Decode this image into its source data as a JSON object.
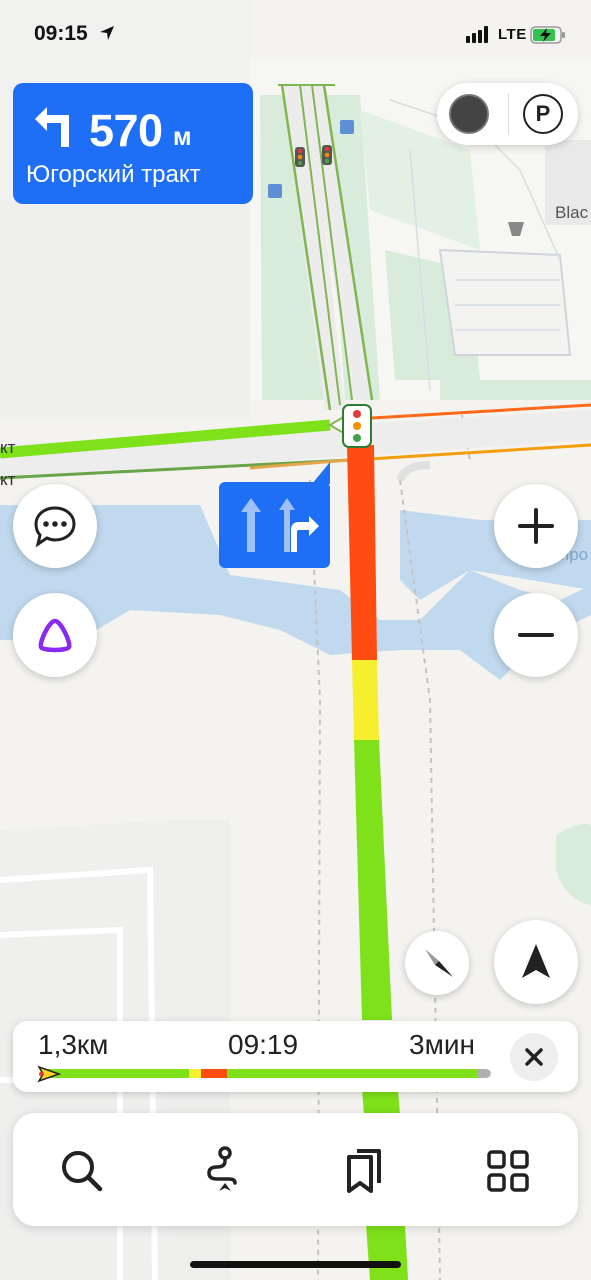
{
  "status_bar": {
    "time": "09:15",
    "network": "LTE",
    "icons": [
      "location-arrow-icon",
      "signal-bars-icon",
      "battery-charging-icon"
    ]
  },
  "maneuver": {
    "icon": "turn-left-arrow-icon",
    "distance": "570",
    "unit": "м",
    "street": "Югорский тракт"
  },
  "map": {
    "labels": {
      "poi_edge": "Blac",
      "road_left_top": "кт",
      "road_left_bottom": "кт",
      "water_right": "про"
    },
    "colors": {
      "water": "#c0d9ee",
      "route_green": "#7ee11a",
      "route_red": "#ff4d12",
      "route_yellow": "#f6ef2e",
      "traffic_orange": "#f59e0b",
      "park": "#d6ead8"
    }
  },
  "top_right_pill": {
    "left_icon": "traffic-layer-icon",
    "right_icon": "parking-icon",
    "right_label": "P"
  },
  "lane_hint": {
    "icons": [
      "lane-straight-icon",
      "lane-straight-right-icon"
    ]
  },
  "controls": {
    "chat": "chat-bubble-icon",
    "alice": "alice-assistant-icon",
    "zoom_in": "plus-icon",
    "zoom_out": "minus-icon",
    "compass": "compass-icon",
    "my_location": "navigation-arrow-icon"
  },
  "route_panel": {
    "distance": "1,3км",
    "arrival": "09:19",
    "duration": "3мин",
    "close_icon": "close-icon",
    "traffic_colors": [
      "#7ee11a",
      "#f6ef2e",
      "#ff4d12",
      "#7ee11a",
      "#b0b0b0"
    ]
  },
  "tab_bar": {
    "items": [
      {
        "name": "search",
        "icon": "search-icon"
      },
      {
        "name": "route",
        "icon": "route-icon"
      },
      {
        "name": "bookmarks",
        "icon": "bookmarks-icon"
      },
      {
        "name": "services",
        "icon": "grid-menu-icon"
      }
    ]
  }
}
